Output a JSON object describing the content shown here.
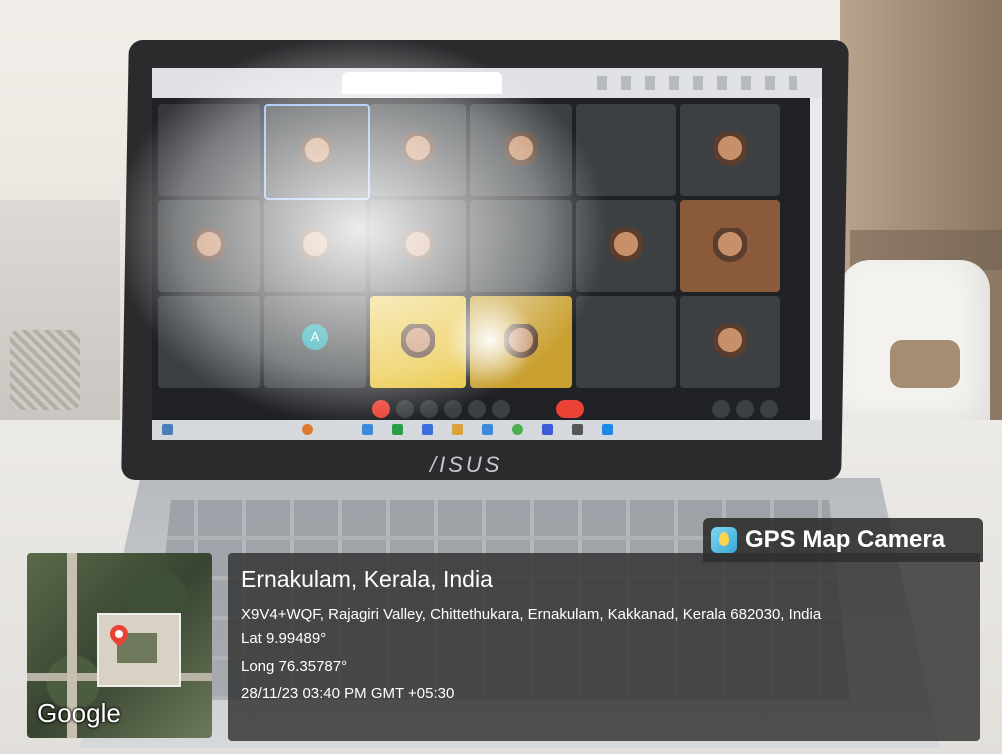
{
  "gps_overlay": {
    "app_name": "GPS Map Camera",
    "place": "Ernakulam, Kerala, India",
    "address": "X9V4+WQF, Rajagiri Valley, Chittethukara, Ernakulam, Kakkanad, Kerala 682030, India",
    "latitude": "Lat 9.99489°",
    "longitude": "Long 76.35787°",
    "datetime": "28/11/23 03:40 PM GMT +05:30",
    "map_attribution": "Google"
  },
  "laptop": {
    "brand": "/ISUS"
  },
  "colors": {
    "overlay_bg": "#303030",
    "pin": "#e94235",
    "meet_bg": "#202124",
    "end_call": "#ea4335"
  }
}
